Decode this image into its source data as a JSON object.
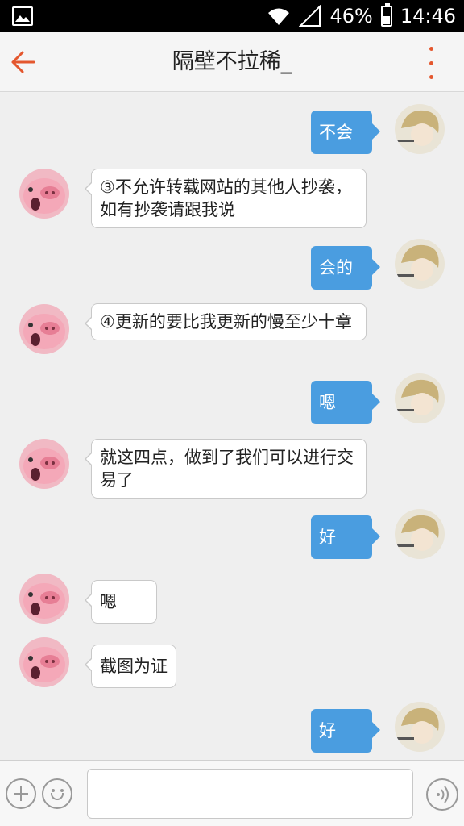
{
  "status_bar": {
    "battery": "46%",
    "time": "14:46"
  },
  "header": {
    "title": "隔壁不拉稀_"
  },
  "messages": [
    {
      "side": "out",
      "text": "不会"
    },
    {
      "side": "in",
      "text": "③不允许转载网站的其他人抄袭，如有抄袭请跟我说"
    },
    {
      "side": "out",
      "text": "会的"
    },
    {
      "side": "in",
      "text": "④更新的要比我更新的慢至少十章"
    },
    {
      "side": "out",
      "text": "嗯"
    },
    {
      "side": "in",
      "text": "就这四点，做到了我们可以进行交易了"
    },
    {
      "side": "out",
      "text": "好"
    },
    {
      "side": "in",
      "text": "嗯"
    },
    {
      "side": "in",
      "text": "截图为证"
    },
    {
      "side": "out",
      "text": "好"
    }
  ],
  "input_bar": {
    "placeholder": ""
  },
  "colors": {
    "accent": "#e4572e",
    "bubble_out": "#4a9de0",
    "bubble_in": "#ffffff"
  },
  "icons": {
    "back": "back-arrow-icon",
    "more": "more-vertical-icon",
    "plus": "plus-icon",
    "emoji": "emoji-icon",
    "voice": "voice-icon"
  }
}
